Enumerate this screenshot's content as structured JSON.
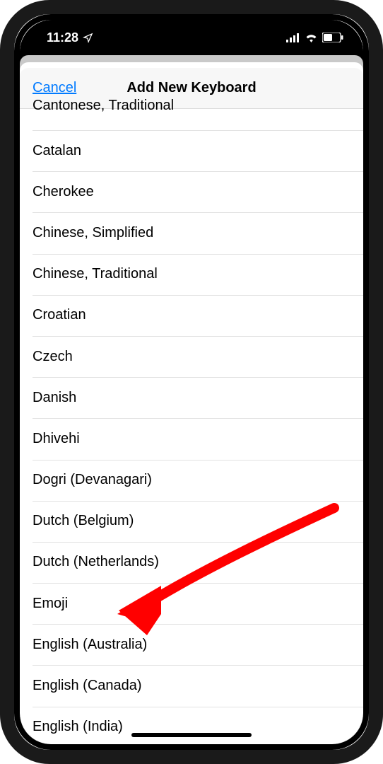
{
  "status_bar": {
    "time": "11:28",
    "location_icon": "location-arrow",
    "signal_icon": "cellular-signal",
    "wifi_icon": "wifi",
    "battery_icon": "battery-half"
  },
  "nav": {
    "cancel": "Cancel",
    "title": "Add New Keyboard"
  },
  "keyboards": [
    "Cantonese, Traditional",
    "Catalan",
    "Cherokee",
    "Chinese, Simplified",
    "Chinese, Traditional",
    "Croatian",
    "Czech",
    "Danish",
    "Dhivehi",
    "Dogri (Devanagari)",
    "Dutch (Belgium)",
    "Dutch (Netherlands)",
    "Emoji",
    "English (Australia)",
    "English (Canada)",
    "English (India)"
  ],
  "annotation": {
    "points_to": "Emoji",
    "color": "#ff0000"
  }
}
